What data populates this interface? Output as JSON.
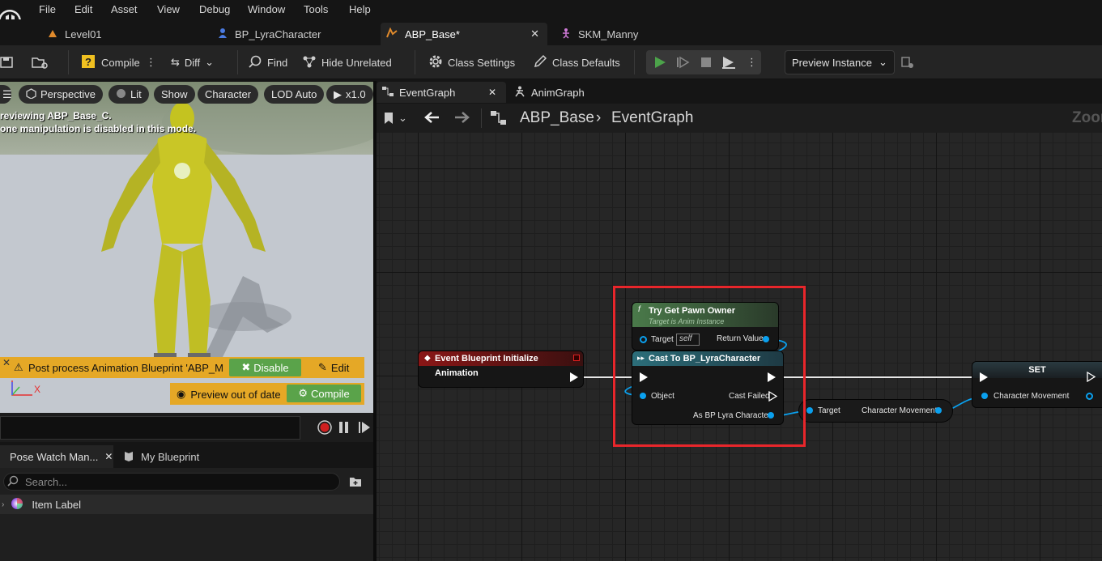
{
  "menu": [
    "File",
    "Edit",
    "Asset",
    "View",
    "Debug",
    "Window",
    "Tools",
    "Help"
  ],
  "asset_tabs": [
    {
      "label": "Level01",
      "icon": "level-icon"
    },
    {
      "label": "BP_LyraCharacter",
      "icon": "pawn-icon"
    },
    {
      "label": "ABP_Base*",
      "icon": "anim-blueprint-icon",
      "active": true
    },
    {
      "label": "SKM_Manny",
      "icon": "skeletal-mesh-icon"
    }
  ],
  "toolbar": {
    "compile": "Compile",
    "diff": "Diff",
    "find": "Find",
    "hide_unrelated": "Hide Unrelated",
    "class_settings": "Class Settings",
    "class_defaults": "Class Defaults",
    "preview_instance": "Preview Instance"
  },
  "viewport": {
    "perspective": "Perspective",
    "lit": "Lit",
    "show": "Show",
    "character": "Character",
    "lod": "LOD Auto",
    "speed": "x1.0",
    "previewing": "reviewing ABP_Base_C.",
    "manipulation": "one manipulation is disabled in this mode.",
    "warning": "Post process Animation Blueprint 'ABP_M",
    "disable": "Disable",
    "edit": "Edit",
    "preview_out_of_date": "Preview out of date",
    "compile": "Compile",
    "axis_x": "X"
  },
  "lower_panel": {
    "tabs": [
      "Pose Watch Man...",
      "My Blueprint"
    ],
    "search_placeholder": "Search...",
    "item_label": "Item Label"
  },
  "graph": {
    "tabs": [
      "EventGraph",
      "AnimGraph"
    ],
    "breadcrumb_root": "ABP_Base",
    "breadcrumb_leaf": "EventGraph",
    "zoom": "Zoom",
    "nodes": {
      "event": {
        "title": "Event Blueprint Initialize Animation"
      },
      "try_get": {
        "title": "Try Get Pawn Owner",
        "subtitle": "Target is Anim Instance",
        "target": "Target",
        "self": "self",
        "return_value": "Return Value"
      },
      "cast": {
        "title": "Cast To BP_LyraCharacter",
        "object": "Object",
        "cast_failed": "Cast Failed",
        "as_bp": "As BP Lyra Character"
      },
      "getter": {
        "target": "Target",
        "output": "Character Movement"
      },
      "set": {
        "title": "SET",
        "input": "Character Movement"
      }
    }
  },
  "colors": {
    "accent_play": "#4ca34a",
    "warning": "#e5a826",
    "highlight": "#e8262b",
    "pin_object": "#0aa0ee"
  }
}
